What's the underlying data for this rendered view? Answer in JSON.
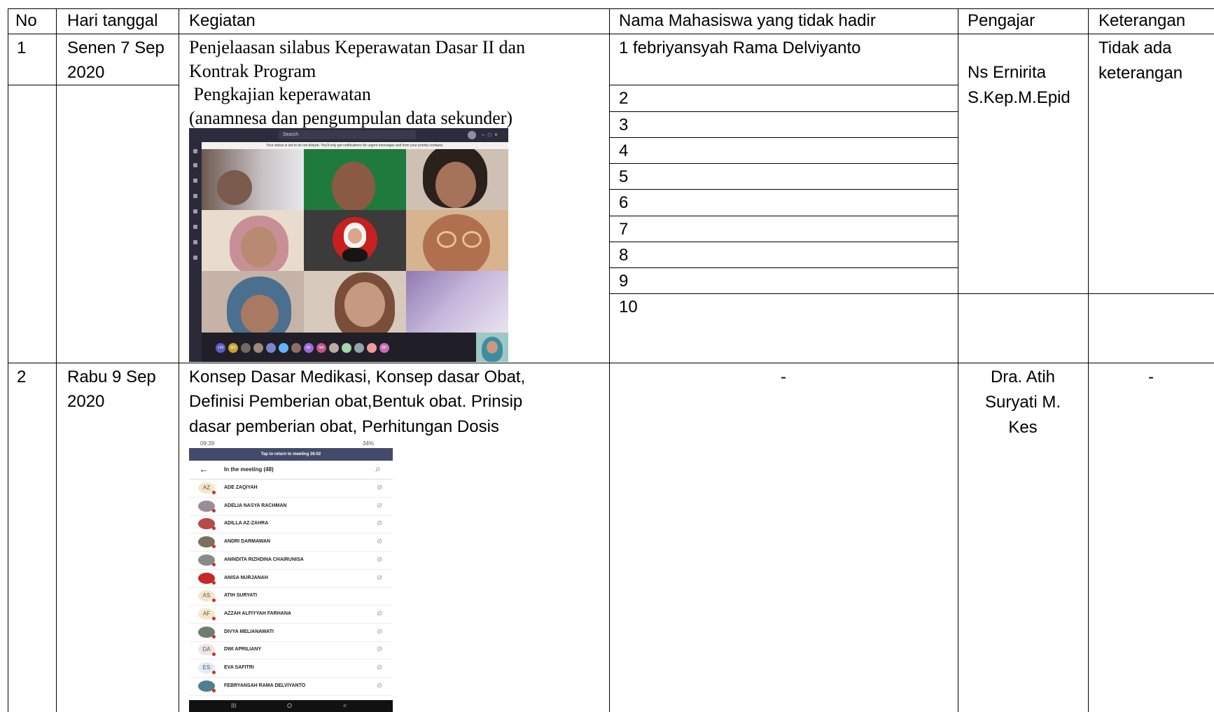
{
  "table": {
    "headers": [
      "No",
      "Hari tanggal",
      "Kegiatan",
      "Nama Mahasiswa yang tidak hadir",
      "Pengajar",
      "Keterangan"
    ],
    "rows": [
      {
        "no": "1",
        "date_lines": [
          "Senen 7 Sep",
          "2020"
        ],
        "activity_lines": [
          "Penjelaasan  silabus Keperawatan Dasar II  dan",
          "Kontrak Program",
          " Pengkajian keperawatan",
          "(anamnesa dan pengumpulan data sekunder)"
        ],
        "absent": [
          "1 febriyansyah Rama Delviyanto",
          "2",
          "3",
          "4",
          "5",
          "6",
          "7",
          "8",
          "9",
          "10"
        ],
        "teacher_lines": [
          "Ns Ernirita",
          "S.Kep.M.Epid"
        ],
        "note_lines": [
          "Tidak ada",
          "keterangan"
        ]
      },
      {
        "no": "2",
        "date_lines": [
          "Rabu 9 Sep",
          "2020"
        ],
        "activity_lines": [
          "Konsep Dasar Medikasi, Konsep dasar Obat,",
          "Definisi Pemberian obat,Bentuk obat. Prinsip",
          "dasar pemberian obat, Perhitungan Dosis"
        ],
        "absent": [
          "-"
        ],
        "teacher_lines": [
          "Dra. Atih",
          "Suryati M.",
          "Kes"
        ],
        "note": "-"
      }
    ]
  },
  "teams_screenshot": {
    "search": "Search",
    "notice": "Your status is set to do not disturb. You'll only get notifications for urgent messages and from your priority contacts.",
    "avatars": [
      "+20",
      "MS",
      "",
      "",
      "",
      "",
      "",
      "AF",
      "NA",
      "",
      "",
      "",
      "",
      "RP"
    ]
  },
  "phone_screenshot": {
    "status_time": "09:39",
    "status_right": "34%",
    "banner": "Tap to return to meeting 36:02",
    "header": "In the meeting (48)",
    "back_icon": "←",
    "search_icon": "⌕",
    "participants": [
      {
        "initials": "AZ",
        "name": "ADE ZAQIYAH"
      },
      {
        "initials": "",
        "name": "ADELIA NASYA RACHMAN"
      },
      {
        "initials": "",
        "name": "ADILLA AZ-ZAHRA"
      },
      {
        "initials": "",
        "name": "ANDRI DARMAWAN"
      },
      {
        "initials": "",
        "name": "ANINDITA RIZHDINA CHAIRUNISA"
      },
      {
        "initials": "",
        "name": "ANISA NURJANAH"
      },
      {
        "initials": "AS",
        "name": "ATIH SURYATI"
      },
      {
        "initials": "AF",
        "name": "AZZAH ALFIYYAH FARHANA"
      },
      {
        "initials": "",
        "name": "DIVYA MELIANAWATI"
      },
      {
        "initials": "DA",
        "name": "DWI APRILIANY"
      },
      {
        "initials": "ES",
        "name": "EVA SAFITRI"
      },
      {
        "initials": "",
        "name": "FEBRYANSAH RAMA DELVIYANTO"
      }
    ],
    "nav": [
      "III",
      "O",
      "<"
    ]
  }
}
